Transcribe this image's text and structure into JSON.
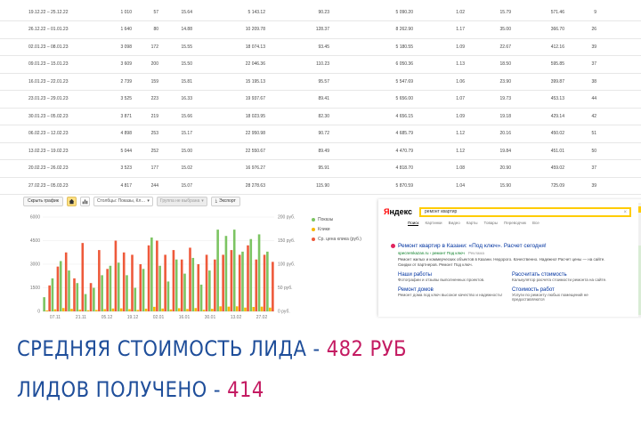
{
  "table": {
    "rows": [
      [
        "19.12.22 – 25.12.22",
        "1 010",
        "57",
        "15.64",
        "5 143.12",
        "90.23",
        "5 090.20",
        "1.02",
        "15.79",
        "571.46",
        "9"
      ],
      [
        "26.12.22 – 01.01.23",
        "1 640",
        "80",
        "14.88",
        "10 209.78",
        "128.37",
        "8 262.90",
        "1.17",
        "35.00",
        "366.70",
        "26"
      ],
      [
        "02.01.23 – 08.01.23",
        "3 098",
        "172",
        "15.55",
        "18 074.13",
        "93.45",
        "5 180.55",
        "1.09",
        "22.67",
        "412.16",
        "39"
      ],
      [
        "09.01.23 – 15.01.23",
        "3 609",
        "200",
        "15.50",
        "22 046.36",
        "110.23",
        "6 050.36",
        "1.13",
        "18.50",
        "595.85",
        "37"
      ],
      [
        "16.01.23 – 22.01.23",
        "2 739",
        "159",
        "15.81",
        "15 195.13",
        "95.57",
        "5 547.69",
        "1.06",
        "23.90",
        "399.87",
        "38"
      ],
      [
        "23.01.23 – 29.01.23",
        "3 525",
        "223",
        "16.33",
        "19 937.67",
        "89.41",
        "5 656.00",
        "1.07",
        "19.73",
        "453.13",
        "44"
      ],
      [
        "30.01.23 – 05.02.23",
        "3 871",
        "219",
        "15.66",
        "18 023.95",
        "82.30",
        "4 656.15",
        "1.09",
        "19.18",
        "429.14",
        "42"
      ],
      [
        "06.02.23 – 12.02.23",
        "4 898",
        "253",
        "15.17",
        "22 950.98",
        "90.72",
        "4 685.79",
        "1.12",
        "20.16",
        "450.02",
        "51"
      ],
      [
        "13.02.23 – 19.02.23",
        "5 044",
        "252",
        "15.00",
        "22 550.67",
        "89.49",
        "4 470.79",
        "1.12",
        "19.84",
        "451.01",
        "50"
      ],
      [
        "20.02.23 – 26.02.23",
        "3 523",
        "177",
        "15.02",
        "16 976.27",
        "95.91",
        "4 818.70",
        "1.08",
        "20.90",
        "459.02",
        "37"
      ],
      [
        "27.02.23 – 05.03.23",
        "4 817",
        "244",
        "15.07",
        "28 278.63",
        "115.90",
        "5 870.59",
        "1.04",
        "15.90",
        "725.09",
        "39"
      ]
    ]
  },
  "toolbar": {
    "hide_chart": "Скрыть график",
    "columns_select": "Столбцы: Показы, Кл…",
    "second_select": "Группа не выбрана",
    "export": "Экспорт"
  },
  "icons": {
    "home": "home-icon",
    "chart_type": "bar-chart-icon",
    "dropdown": "chevron-down-icon",
    "export": "download-icon",
    "clear": "close-icon"
  },
  "legend": {
    "shows": "Показы",
    "clicks": "Клики",
    "cpc": "Ср. цена клика (руб.)"
  },
  "chart_data": {
    "type": "bar",
    "x_tick_labels": [
      "07.11",
      "21.11",
      "05.12",
      "19.12",
      "02.01",
      "16.01",
      "30.01",
      "13.02",
      "27.02"
    ],
    "y_left_ticks": [
      "0",
      "1500",
      "3000",
      "4500",
      "6000"
    ],
    "y_right_ticks": [
      "0 руб.",
      "50 руб.",
      "100 руб.",
      "150 руб.",
      "200 руб."
    ],
    "ylim_left": [
      0,
      6000
    ],
    "ylim_right": [
      0,
      200
    ],
    "series": [
      {
        "name": "Показы",
        "color": "#7cc462",
        "axis": "left",
        "values": [
          900,
          2100,
          3200,
          2600,
          1800,
          1100,
          1500,
          2300,
          2900,
          3100,
          2300,
          1500,
          2700,
          4700,
          2900,
          1900,
          3300,
          2400,
          3400,
          1700,
          2600,
          5200,
          4800,
          5200,
          3800,
          4600,
          4900,
          3800
        ]
      },
      {
        "name": "Клики",
        "color": "#f5b800",
        "axis": "left",
        "values": [
          60,
          130,
          210,
          160,
          110,
          70,
          90,
          140,
          180,
          190,
          140,
          90,
          170,
          290,
          180,
          120,
          200,
          150,
          210,
          100,
          160,
          320,
          300,
          320,
          240,
          280,
          300,
          240
        ]
      },
      {
        "name": "Ср. цена клика (руб.)",
        "color": "#ee5a3b",
        "axis": "right",
        "values": [
          55,
          95,
          125,
          70,
          145,
          60,
          130,
          90,
          150,
          125,
          120,
          100,
          140,
          150,
          120,
          130,
          110,
          135,
          100,
          120,
          110,
          120,
          130,
          120,
          140,
          110,
          120,
          105
        ]
      }
    ],
    "title": "",
    "xlabel": "",
    "ylabel": "",
    "grid": true,
    "legend_position": "right"
  },
  "yandex": {
    "logo_first": "Я",
    "logo_rest": "ндекс",
    "query": "ремонт квартир",
    "clear_symbol": "×",
    "tabs": [
      "Поиск",
      "Картинки",
      "Видео",
      "Карты",
      "Товары",
      "Переводчик",
      "Все"
    ],
    "ad_title": "Ремонт квартир в Казани: «Под ключ». Расчет сегодня!",
    "ad_url": "specremkazan.ru › ремонт Под ключ",
    "ad_label": "Реклама",
    "ad_text": "Ремонт жилых и коммерческих объектов в Казани. Недорого. Качественно. Надежно! Расчет цены — на сайте. Скидки от партнеров. Ремонт Под ключ.",
    "links": [
      {
        "title": "Наши работы",
        "desc": "Фотографии и отзывы выполненных проектов."
      },
      {
        "title": "Рассчитать стоимость",
        "desc": "Калькулятор расчета стоимости ремонта на сайте."
      },
      {
        "title": "Ремонт домов",
        "desc": "Ремонт дома под ключ высокое качество и надежность!"
      },
      {
        "title": "Стоимость работ",
        "desc": "Услуги по ремонту любых помещений не предоставляются"
      }
    ]
  },
  "captions": {
    "cost_label": "СРЕДНЯЯ СТОИМОСТЬ ЛИДА - ",
    "cost_value": "482 РУБ",
    "leads_label": "ЛИДОВ ПОЛУЧЕНО - ",
    "leads_value": "414"
  }
}
